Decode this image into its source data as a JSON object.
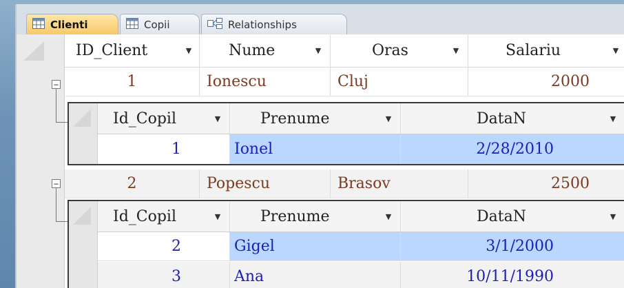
{
  "tabs": [
    {
      "label": "Clienti",
      "icon": "table-icon",
      "active": true
    },
    {
      "label": "Copii",
      "icon": "table-icon",
      "active": false
    },
    {
      "label": "Relationships",
      "icon": "relationships-icon",
      "active": false
    }
  ],
  "clients_table": {
    "columns": [
      "ID_Client",
      "Nume",
      "Oras",
      "Salariu"
    ],
    "rows": [
      {
        "id": "1",
        "nume": "Ionescu",
        "oras": "Cluj",
        "salariu": "2000"
      },
      {
        "id": "2",
        "nume": "Popescu",
        "oras": "Brasov",
        "salariu": "2500"
      }
    ]
  },
  "children_table": {
    "columns": [
      "Id_Copil",
      "Prenume",
      "DataN"
    ],
    "groups": [
      {
        "rows": [
          {
            "id": "1",
            "prenume": "Ionel",
            "datan": "2/28/2010"
          }
        ]
      },
      {
        "rows": [
          {
            "id": "2",
            "prenume": "Gigel",
            "datan": "3/1/2000"
          },
          {
            "id": "3",
            "prenume": "Ana",
            "datan": "10/11/1990"
          }
        ]
      }
    ]
  },
  "colors": {
    "highlight": "#b9d7ff",
    "client_text": "#7b3a21",
    "child_text": "#1e1eb4",
    "active_tab": "#f9c86a"
  }
}
